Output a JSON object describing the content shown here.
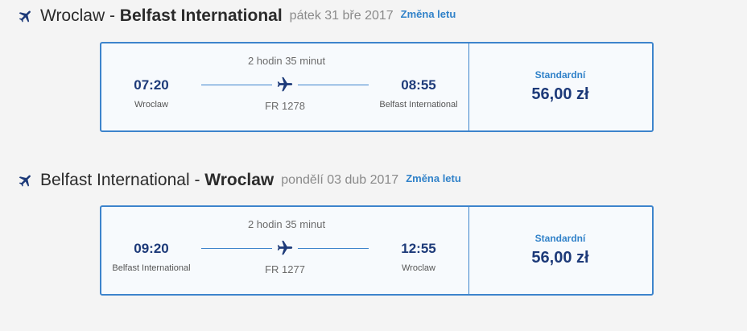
{
  "legs": [
    {
      "from": "Wroclaw",
      "separator": " - ",
      "to": "Belfast International",
      "date": "pátek 31 bře 2017",
      "change_label": "Změna letu",
      "duration": "2 hodin 35 minut",
      "departure_time": "07:20",
      "departure_city": "Wroclaw",
      "arrival_time": "08:55",
      "arrival_city": "Belfast International",
      "flight_number": "FR 1278",
      "fare_name": "Standardní",
      "price": "56,00 zł"
    },
    {
      "from": "Belfast International",
      "separator": " - ",
      "to": "Wroclaw",
      "date": "pondělí 03 dub 2017",
      "change_label": "Změna letu",
      "duration": "2 hodin 35 minut",
      "departure_time": "09:20",
      "departure_city": "Belfast International",
      "arrival_time": "12:55",
      "arrival_city": "Wroclaw",
      "flight_number": "FR 1277",
      "fare_name": "Standardní",
      "price": "56,00 zł"
    }
  ],
  "icons": {
    "leg_header": "airplane-icon",
    "flight_path": "airplane-icon"
  },
  "colors": {
    "accent": "#3d84cc",
    "time_text": "#1d3a79",
    "link": "#3182c9",
    "card_bg": "#f7fafd"
  }
}
